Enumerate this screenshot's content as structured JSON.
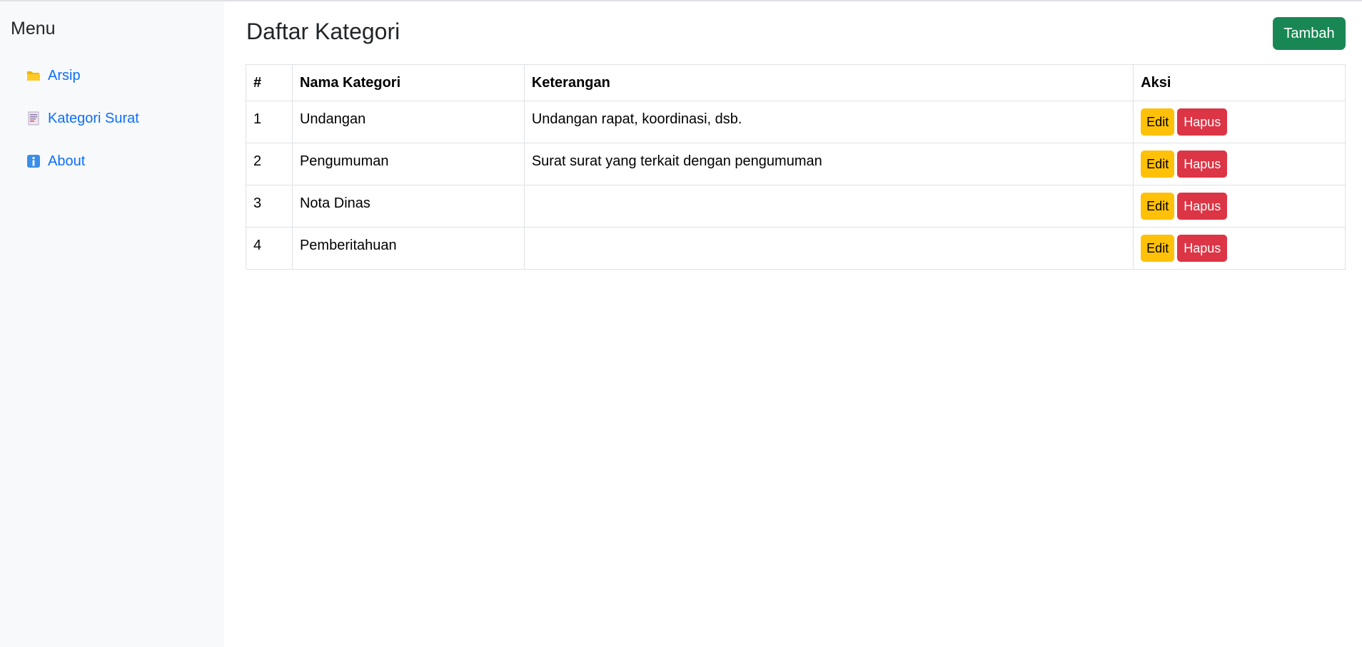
{
  "sidebar": {
    "title": "Menu",
    "items": [
      {
        "label": "Arsip",
        "icon": "folder-icon"
      },
      {
        "label": "Kategori Surat",
        "icon": "document-icon"
      },
      {
        "label": "About",
        "icon": "info-icon"
      }
    ]
  },
  "main": {
    "title": "Daftar Kategori",
    "add_label": "Tambah",
    "table": {
      "headers": [
        "#",
        "Nama Kategori",
        "Keterangan",
        "Aksi"
      ],
      "rows": [
        {
          "no": "1",
          "name": "Undangan",
          "desc": "Undangan rapat, koordinasi, dsb."
        },
        {
          "no": "2",
          "name": "Pengumuman",
          "desc": "Surat surat yang terkait dengan pengumuman"
        },
        {
          "no": "3",
          "name": "Nota Dinas",
          "desc": ""
        },
        {
          "no": "4",
          "name": "Pemberitahuan",
          "desc": ""
        }
      ],
      "edit_label": "Edit",
      "delete_label": "Hapus"
    }
  },
  "colors": {
    "sidebar_bg": "#f8f9fa",
    "link": "#0d6efd",
    "add_button": "#198754",
    "edit_button": "#ffc107",
    "delete_button": "#dc3545",
    "border": "#dee2e6"
  }
}
